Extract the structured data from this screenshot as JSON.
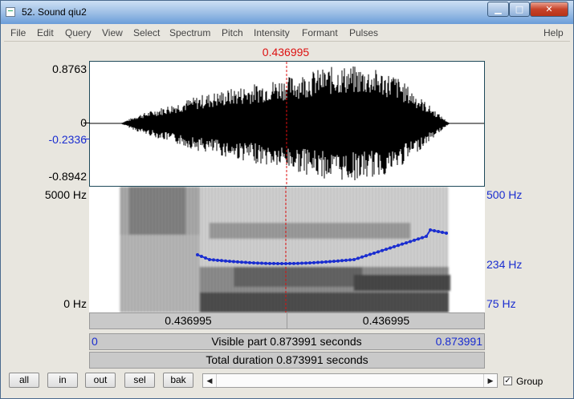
{
  "window": {
    "title": "52. Sound qiu2",
    "controls": {
      "minimize": "▁",
      "maximize": "□",
      "close": "✕"
    }
  },
  "menu": [
    "File",
    "Edit",
    "Query",
    "View",
    "Select",
    "Spectrum",
    "Pitch",
    "Intensity",
    "Formant",
    "Pulses",
    "Help"
  ],
  "waveform": {
    "cursor_time": "0.436995",
    "y_max": "0.8763",
    "y_zero": "0",
    "y_cursor_value": "-0.2336",
    "y_min": "-0.8942"
  },
  "spectrogram": {
    "freq_max": "5000 Hz",
    "freq_min": "0 Hz",
    "pitch_max": "500 Hz",
    "pitch_cursor": "234 Hz",
    "pitch_min": "75 Hz"
  },
  "time_bars": {
    "left_segment": "0.436995",
    "right_segment": "0.436995",
    "visible_start": "0",
    "visible_label": "Visible part 0.873991 seconds",
    "visible_end": "0.873991",
    "total_label": "Total duration 0.873991 seconds"
  },
  "buttons": {
    "all": "all",
    "in": "in",
    "out": "out",
    "sel": "sel",
    "bak": "bak"
  },
  "group": {
    "label": "Group",
    "checked": true,
    "check_glyph": "✓"
  },
  "scroll_arrows": {
    "left": "◀",
    "right": "▶"
  },
  "colors": {
    "cursor": "#dd1111",
    "pitch": "#1a2dd0",
    "axis_blue": "#1a2dd0"
  }
}
